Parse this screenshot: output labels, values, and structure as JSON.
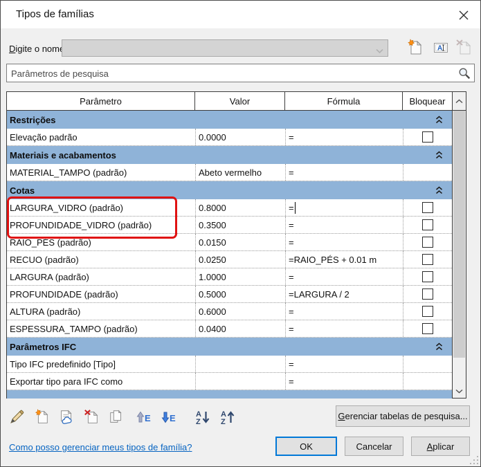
{
  "window": {
    "title": "Tipos de famílias"
  },
  "name_field": {
    "label": "Digite o nome:",
    "accel": "D",
    "value": "",
    "state": "disabled"
  },
  "search": {
    "placeholder": "Parâmetros de pesquisa"
  },
  "table": {
    "columns": [
      "Parâmetro",
      "Valor",
      "Fórmula",
      "Bloquear"
    ],
    "rows": [
      {
        "type": "section",
        "label": "Restrições"
      },
      {
        "type": "param",
        "name": "Elevação padrão",
        "value": "0.0000",
        "formula": "=",
        "lock": true
      },
      {
        "type": "section",
        "label": "Materiais e acabamentos"
      },
      {
        "type": "param",
        "name": "MATERIAL_TAMPO (padrão)",
        "value": "Abeto vermelho",
        "formula": "=",
        "lock": false
      },
      {
        "type": "section",
        "label": "Cotas"
      },
      {
        "type": "param",
        "name": "LARGURA_VIDRO (padrão)",
        "value": "0.8000",
        "formula": "=",
        "lock": true,
        "caret": true
      },
      {
        "type": "param",
        "name": "PROFUNDIDADE_VIDRO (padrão)",
        "value": "0.3500",
        "formula": "=",
        "lock": true
      },
      {
        "type": "param",
        "name": "RAIO_PÉS (padrão)",
        "value": "0.0150",
        "formula": "=",
        "lock": true
      },
      {
        "type": "param",
        "name": "RECUO (padrão)",
        "value": "0.0250",
        "formula": "=RAIO_PÉS + 0.01 m",
        "lock": true
      },
      {
        "type": "param",
        "name": "LARGURA (padrão)",
        "value": "1.0000",
        "formula": "=",
        "lock": true
      },
      {
        "type": "param",
        "name": "PROFUNDIDADE (padrão)",
        "value": "0.5000",
        "formula": "=LARGURA / 2",
        "lock": true
      },
      {
        "type": "param",
        "name": "ALTURA (padrão)",
        "value": "0.6000",
        "formula": "=",
        "lock": true
      },
      {
        "type": "param",
        "name": "ESPESSURA_TAMPO (padrão)",
        "value": "0.0400",
        "formula": "=",
        "lock": true
      },
      {
        "type": "section",
        "label": "Parâmetros IFC"
      },
      {
        "type": "param",
        "name": "Tipo IFC predefinido [Tipo]",
        "value": "",
        "formula": "=",
        "lock": false
      },
      {
        "type": "param",
        "name": "Exportar tipo para IFC como",
        "value": "",
        "formula": "=",
        "lock": false
      },
      {
        "type": "section-partial",
        "label": ""
      }
    ]
  },
  "annotation": {
    "type": "highlight-box",
    "color": "#e01212",
    "targets": [
      "LARGURA_VIDRO (padrão)",
      "PROFUNDIDADE_VIDRO (padrão)"
    ]
  },
  "type_actions": {
    "icons": [
      "new-type-icon",
      "rename-type-icon",
      "delete-type-icon"
    ],
    "delete_state": "disabled"
  },
  "toolbar_icons": [
    "edit-parameter-icon",
    "new-parameter-icon",
    "shared-parameter-icon",
    "delete-parameter-icon",
    "duplicate-parameter-icon",
    "move-up-icon",
    "move-down-icon",
    "sort-ascending-icon",
    "sort-descending-icon"
  ],
  "footer": {
    "manage_lookup_label": "Gerenciar tabelas de pesquisa...",
    "manage_accel": "G",
    "help_link": "Como posso gerenciar meus tipos de família?",
    "ok": "OK",
    "cancel": "Cancelar",
    "apply": "Aplicar",
    "apply_accel": "A"
  },
  "colors": {
    "section_header": "#8fb3d8",
    "highlight": "#e01212",
    "ok_focus": "#0078d7",
    "link": "#0563c1"
  }
}
